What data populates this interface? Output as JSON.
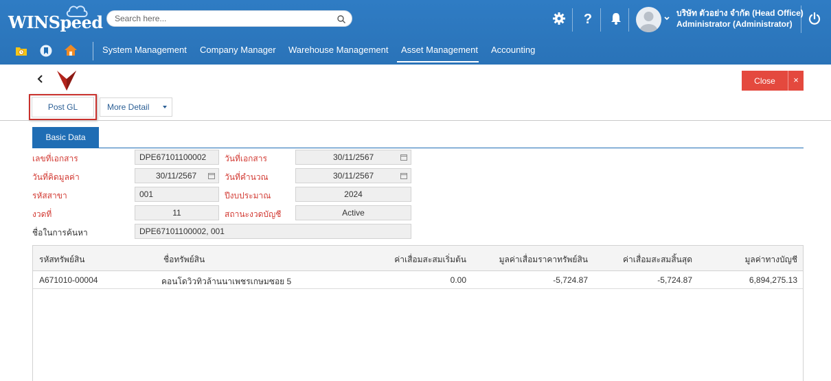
{
  "header": {
    "brand": "WINSpeed",
    "search_placeholder": "Search here...",
    "company": "บริษัท ตัวอย่าง จำกัด (Head Office)",
    "user": "Administrator (Administrator)"
  },
  "nav": {
    "items": [
      {
        "label": "System Management"
      },
      {
        "label": "Company Manager"
      },
      {
        "label": "Warehouse Management"
      },
      {
        "label": "Asset Management",
        "active": true
      },
      {
        "label": "Accounting"
      }
    ]
  },
  "toolbar": {
    "close_label": "Close",
    "close_x": "×",
    "post_gl_label": "Post GL",
    "more_detail_label": "More Detail"
  },
  "tabs": [
    {
      "label": "Basic Data",
      "active": true
    }
  ],
  "form": {
    "doc_no_label": "เลขที่เอกสาร",
    "doc_no": "DPE67101100002",
    "doc_date_label": "วันที่เอกสาร",
    "doc_date": "30/11/2567",
    "value_date_label": "วันที่คิดมูลค่า",
    "value_date": "30/11/2567",
    "calc_date_label": "วันที่คำนวณ",
    "calc_date": "30/11/2567",
    "branch_label": "รหัสสาขา",
    "branch": "001",
    "fiscal_year_label": "ปีงบประมาณ",
    "fiscal_year": "2024",
    "period_label": "งวดที่",
    "period": "11",
    "period_status_label": "สถานะงวดบัญชี",
    "period_status": "Active",
    "search_name_label": "ชื่อในการค้นหา",
    "search_name": "DPE67101100002, 001"
  },
  "table": {
    "columns": [
      "รหัสทรัพย์สิน",
      "ชื่อทรัพย์สิน",
      "ค่าเสื่อมสะสมเริ่มต้น",
      "มูลค่าเสื่อมราคาทรัพย์สิน",
      "ค่าเสื่อมสะสมสิ้นสุด",
      "มูลค่าทางบัญชี"
    ],
    "rows": [
      {
        "code": "A671010-00004",
        "name": "คอนโดวิวทิวล้านนาเพชรเกษมซอย 5",
        "opening_dep": "0.00",
        "dep_value": "-5,724.87",
        "ending_dep": "-5,724.87",
        "book_value": "6,894,275.13"
      }
    ]
  },
  "colors": {
    "header_bg": "#2f7cc4",
    "accent": "#1f6db4",
    "close_red": "#e4493e",
    "required_label": "#d23a33"
  },
  "icons": [
    "search-icon",
    "gear-icon",
    "help-icon",
    "bell-icon",
    "avatar",
    "chevron-down-icon",
    "power-icon",
    "folder-clock-icon",
    "bookmark-icon",
    "home-icon",
    "back-arrow-icon",
    "calendar-icon"
  ]
}
